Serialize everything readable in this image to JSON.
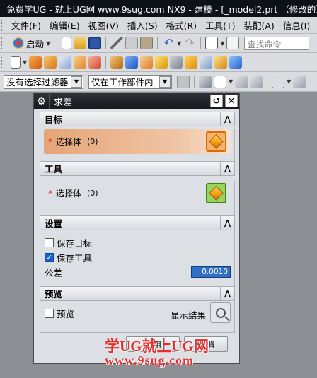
{
  "window": {
    "title": "免费学UG - 就上UG网 www.9sug.com   NX9 - 建模 - [_model2.prt （修改的）"
  },
  "menu": {
    "items": [
      "文件(F)",
      "编辑(E)",
      "视图(V)",
      "插入(S)",
      "格式(R)",
      "工具(T)",
      "装配(A)",
      "信息(I)"
    ]
  },
  "toolbar": {
    "start_label": "启动",
    "search_placeholder": "查找命令"
  },
  "filters": {
    "type_filter": "没有选择过滤器",
    "scope_filter": "仅在工作部件内"
  },
  "dialog": {
    "title": "求差",
    "sections": {
      "target": {
        "header": "目标",
        "select_label": "选择体",
        "select_count": "(0)"
      },
      "tool": {
        "header": "工具",
        "select_label": "选择体",
        "select_count": "(0)"
      },
      "settings": {
        "header": "设置",
        "keep_target_label": "保存目标",
        "keep_target_checked": false,
        "keep_tool_label": "保存工具",
        "keep_tool_checked": true,
        "tolerance_label": "公差",
        "tolerance_value": "0.0010"
      },
      "preview": {
        "header": "预览",
        "preview_label": "预览",
        "preview_checked": false,
        "show_result_label": "显示结果"
      }
    },
    "buttons": {
      "apply": "应用",
      "cancel": "取消"
    }
  },
  "watermark": {
    "line1": "学UG就上UG网",
    "line2": "www.9sug.com"
  }
}
